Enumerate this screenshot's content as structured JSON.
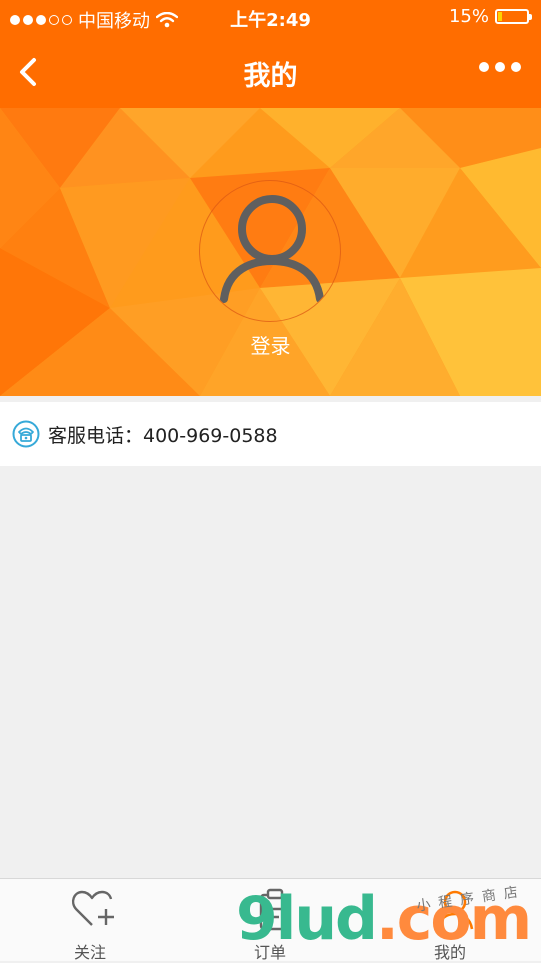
{
  "status_bar": {
    "carrier": "中国移动",
    "time": "上午2:49",
    "battery_percent": "15%",
    "battery_level": 0.15,
    "signal_bars": 3,
    "signal_total": 5
  },
  "nav": {
    "title": "我的",
    "back_icon": "chevron-left-icon",
    "more_icon": "more-dots-icon"
  },
  "profile": {
    "login_label": "登录",
    "avatar_icon": "user-avatar-icon"
  },
  "contact": {
    "label": "客服电话：400-969-0588",
    "icon": "telephone-icon"
  },
  "tabs": [
    {
      "label": "关注",
      "icon": "heart-plus-icon"
    },
    {
      "label": "订单",
      "icon": "order-clipboard-icon"
    },
    {
      "label": "我的",
      "icon": "user-icon"
    }
  ],
  "watermark": {
    "brand": "9lud.com",
    "slogan": "小程序商店"
  },
  "colors": {
    "brand_orange": "#ff6d00",
    "hero_orange": "#ff9a1a",
    "background": "#f0f0f0",
    "phone_icon": "#36a9d8"
  }
}
